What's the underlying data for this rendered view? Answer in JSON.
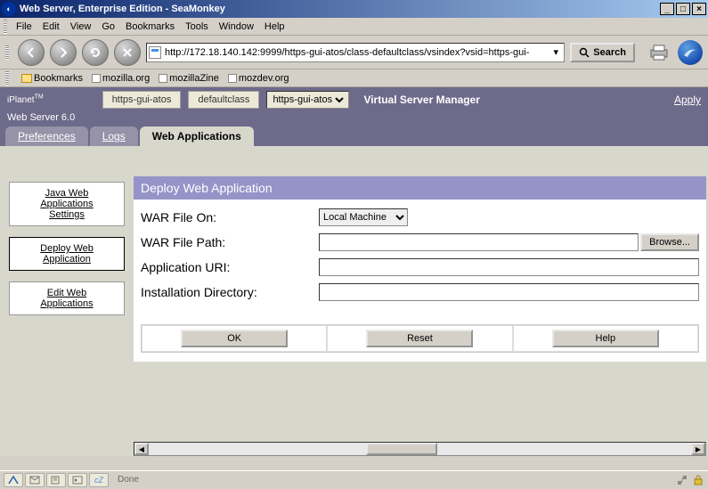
{
  "window": {
    "title": "Web Server, Enterprise Edition - SeaMonkey",
    "min": "_",
    "max": "□",
    "close": "×"
  },
  "menu": {
    "file": "File",
    "edit": "Edit",
    "view": "View",
    "go": "Go",
    "bookmarks": "Bookmarks",
    "tools": "Tools",
    "window": "Window",
    "help": "Help"
  },
  "nav": {
    "url": "http://172.18.140.142:9999/https-gui-atos/class-defaultclass/vsindex?vsid=https-gui-",
    "search": "Search"
  },
  "bookmarks": {
    "folder": "Bookmarks",
    "l1": "mozilla.org",
    "l2": "mozillaZine",
    "l3": "mozdev.org"
  },
  "appbar": {
    "brand_line1": "iPlanet",
    "brand_tm": "TM",
    "brand_line2": "Web Server 6.0",
    "bc1": "https-gui-atos",
    "bc2": "defaultclass",
    "bc3": "https-gui-atos",
    "vsm": "Virtual Server Manager",
    "apply": "Apply"
  },
  "tabs": {
    "preferences": "Preferences",
    "logs": "Logs",
    "webapps": "Web Applications"
  },
  "side": {
    "settings_l1": "Java Web",
    "settings_l2": "Applications",
    "settings_l3": "Settings",
    "deploy_l1": "Deploy Web",
    "deploy_l2": "Application",
    "edit_l1": "Edit Web",
    "edit_l2": "Applications"
  },
  "panel": {
    "title": "Deploy Web Application",
    "war_on_label": "WAR File On:",
    "war_on_value": "Local Machine",
    "war_path_label": "WAR File Path:",
    "war_path_value": "",
    "browse": "Browse...",
    "app_uri_label": "Application URI:",
    "app_uri_value": "",
    "inst_dir_label": "Installation Directory:",
    "inst_dir_value": "",
    "ok": "OK",
    "reset": "Reset",
    "help": "Help"
  },
  "status": {
    "done": "Done"
  }
}
